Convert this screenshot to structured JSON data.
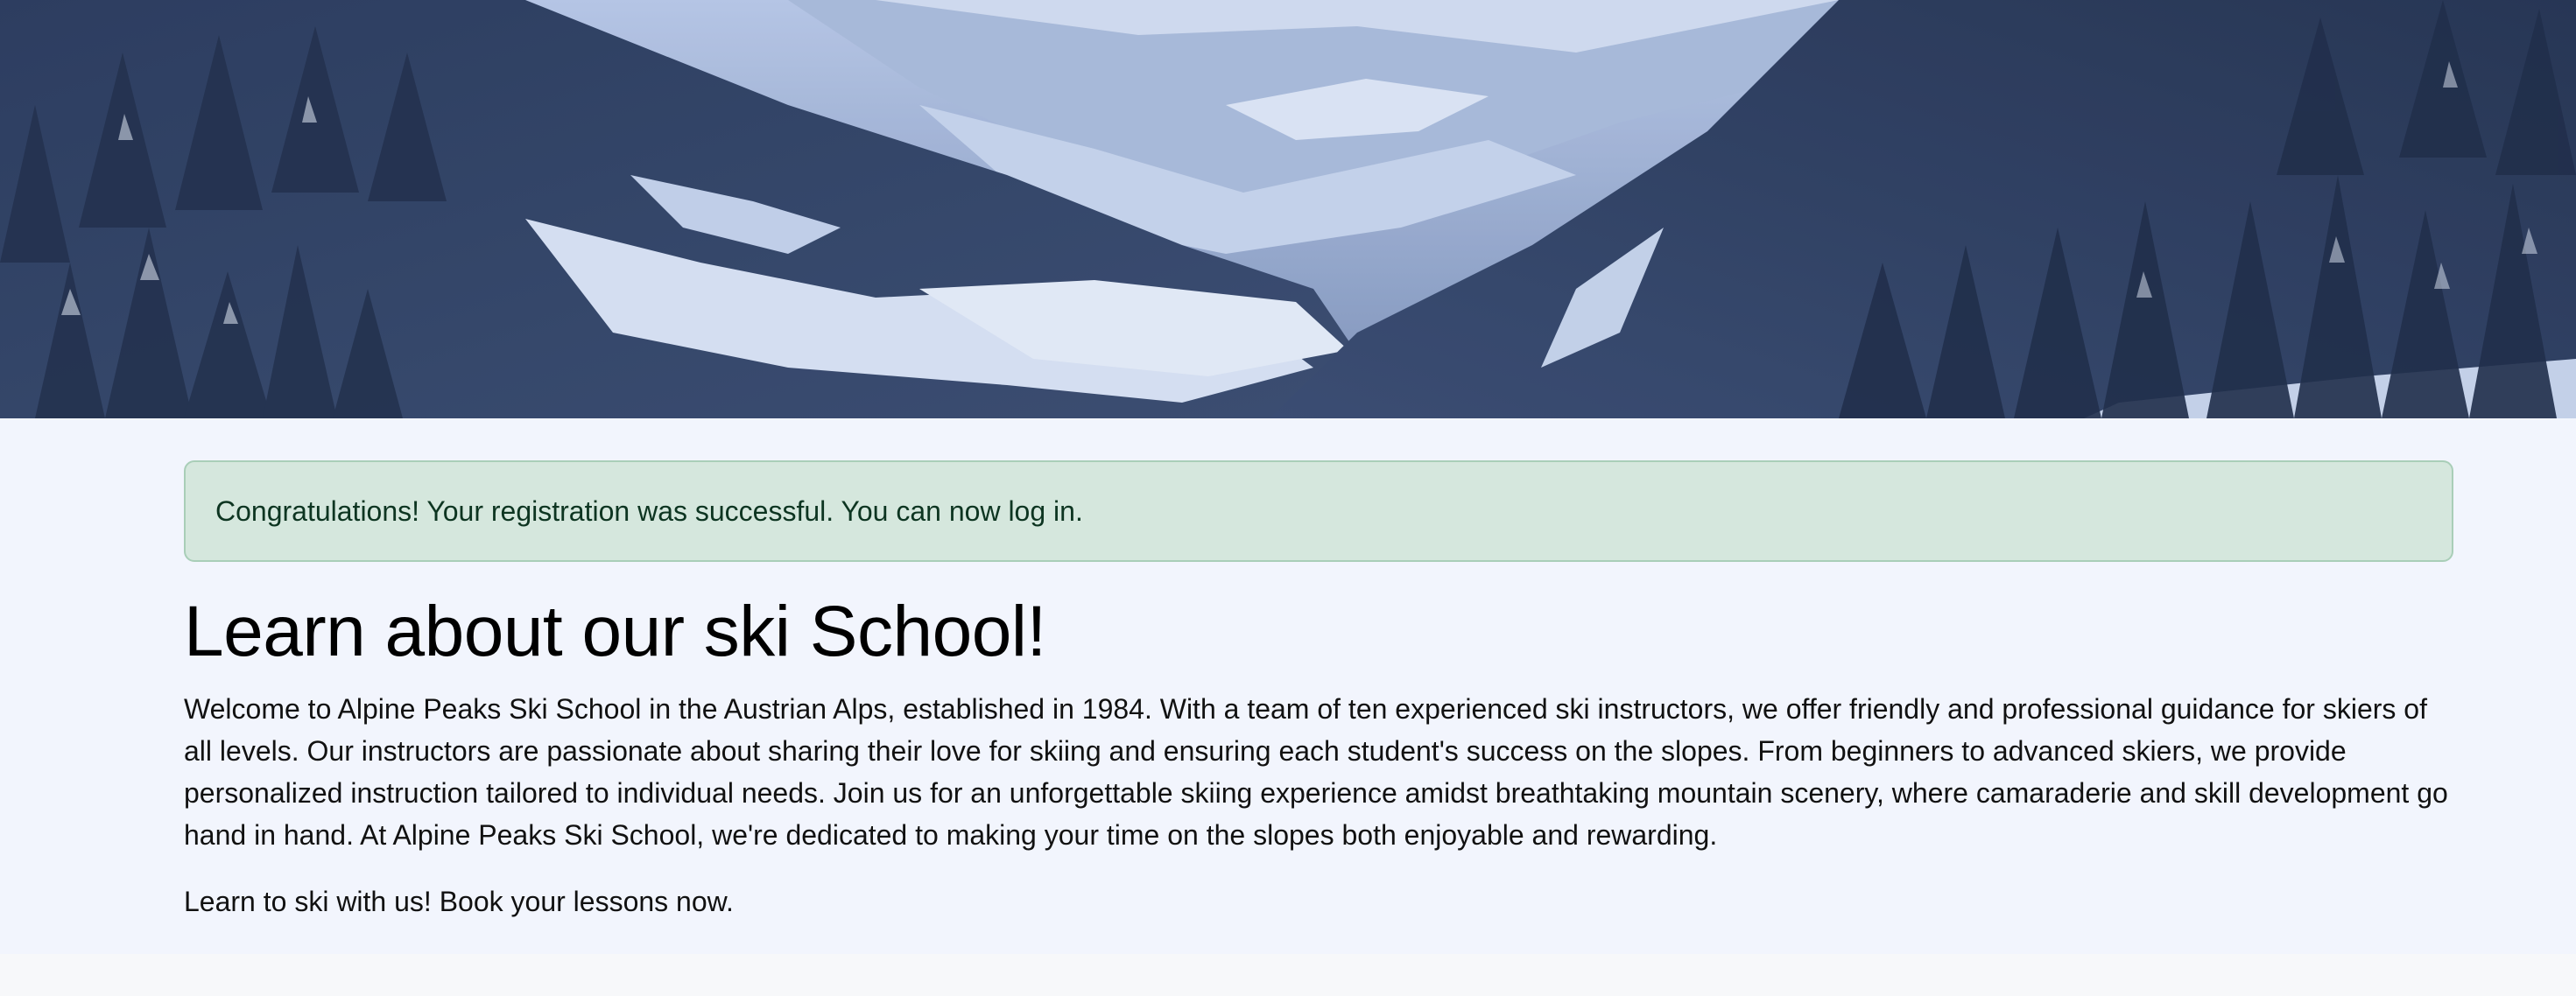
{
  "hero": {
    "image_alt": "Snowy mountain valley with pine forest"
  },
  "alert": {
    "message": "Congratulations! Your registration was successful. You can now log in."
  },
  "main": {
    "title": "Learn about our ski School!",
    "intro": "Welcome to Alpine Peaks Ski School in the Austrian Alps, established in 1984. With a team of ten experienced ski instructors, we offer friendly and professional guidance for skiers of all levels. Our instructors are passionate about sharing their love for skiing and ensuring each student's success on the slopes. From beginners to advanced skiers, we provide personalized instruction tailored to individual needs. Join us for an unforgettable skiing experience amidst breathtaking mountain scenery, where camaraderie and skill development go hand in hand. At Alpine Peaks Ski School, we're dedicated to making your time on the slopes both enjoyable and rewarding.",
    "cta": "Learn to ski with us! Book your lessons now."
  },
  "colors": {
    "alert_bg": "#d5e7dd",
    "alert_border": "#a9ceb8",
    "alert_text": "#0d3521",
    "page_bg": "#f2f5fd"
  }
}
